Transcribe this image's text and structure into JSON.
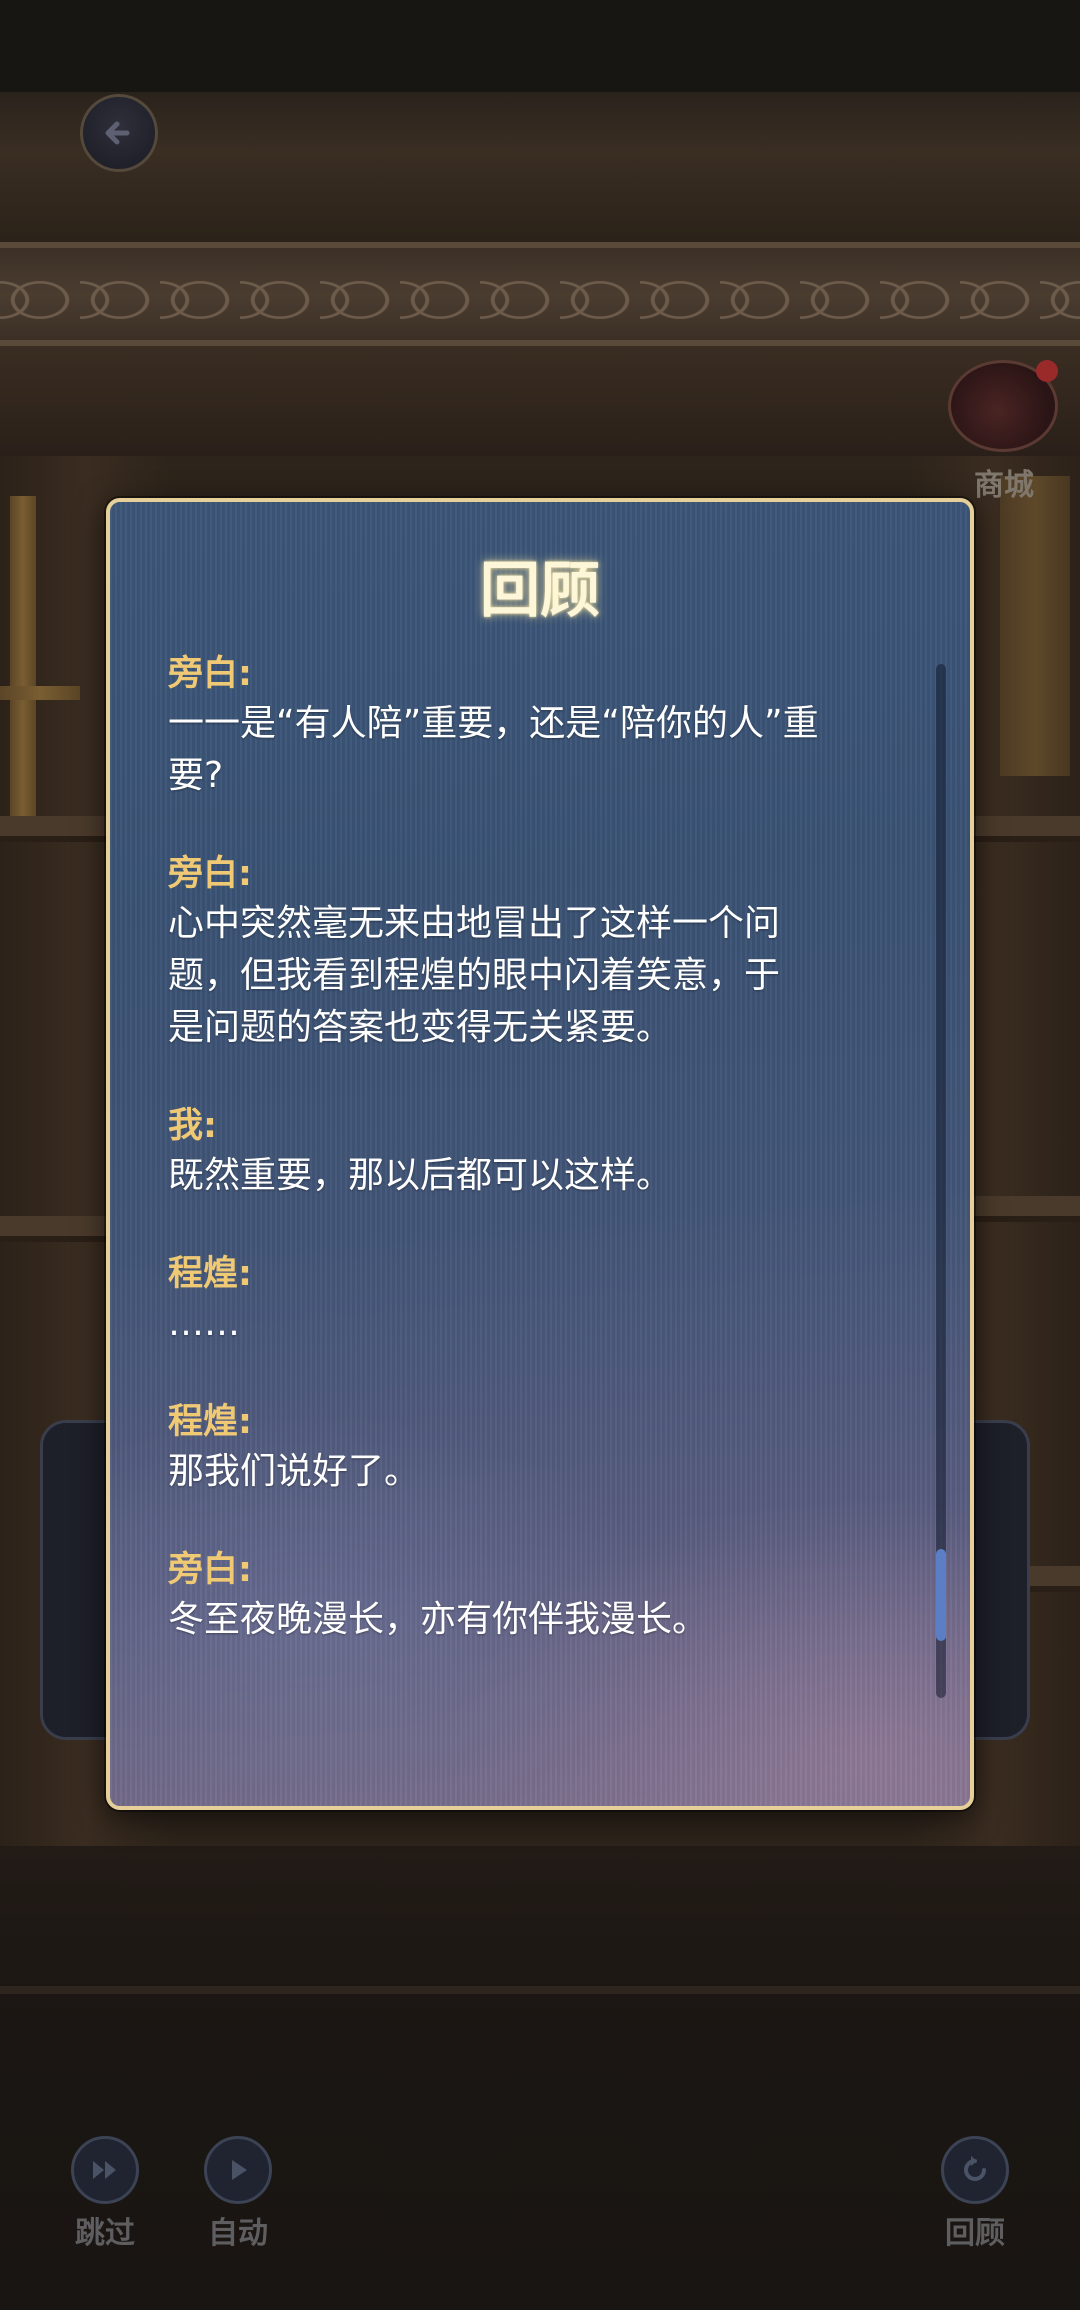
{
  "dialog": {
    "title": "回顾",
    "scroll_position": 0.94,
    "entries": [
      {
        "speaker": "旁白:",
        "text": [
          "一一是“有人陪”重要，还是“陪你的人”重",
          "要?"
        ]
      },
      {
        "speaker": "旁白:",
        "text": [
          "心中突然毫无来由地冒出了这样一个问",
          "题，但我看到程煌的眼中闪着笑意，于",
          "是问题的答案也变得无关紧要。"
        ]
      },
      {
        "speaker": "我:",
        "text": [
          "既然重要，那以后都可以这样。"
        ]
      },
      {
        "speaker": "程煌:",
        "text": [
          "……"
        ]
      },
      {
        "speaker": "程煌:",
        "text": [
          "那我们说好了。"
        ]
      },
      {
        "speaker": "旁白:",
        "text": [
          "冬至夜晚漫长，亦有你伴我漫长。"
        ]
      }
    ]
  },
  "top_bar": {
    "back_icon": "back-arrow-icon"
  },
  "shop": {
    "label": "商城",
    "icon": "character-avatar-icon",
    "has_notification": true
  },
  "controls": {
    "skip_label": "跳过",
    "auto_label": "自动",
    "review_label": "回顾"
  },
  "colors": {
    "speaker": "#f0c974",
    "dialog_border": "#e6cf98",
    "text": "#ffffff"
  }
}
